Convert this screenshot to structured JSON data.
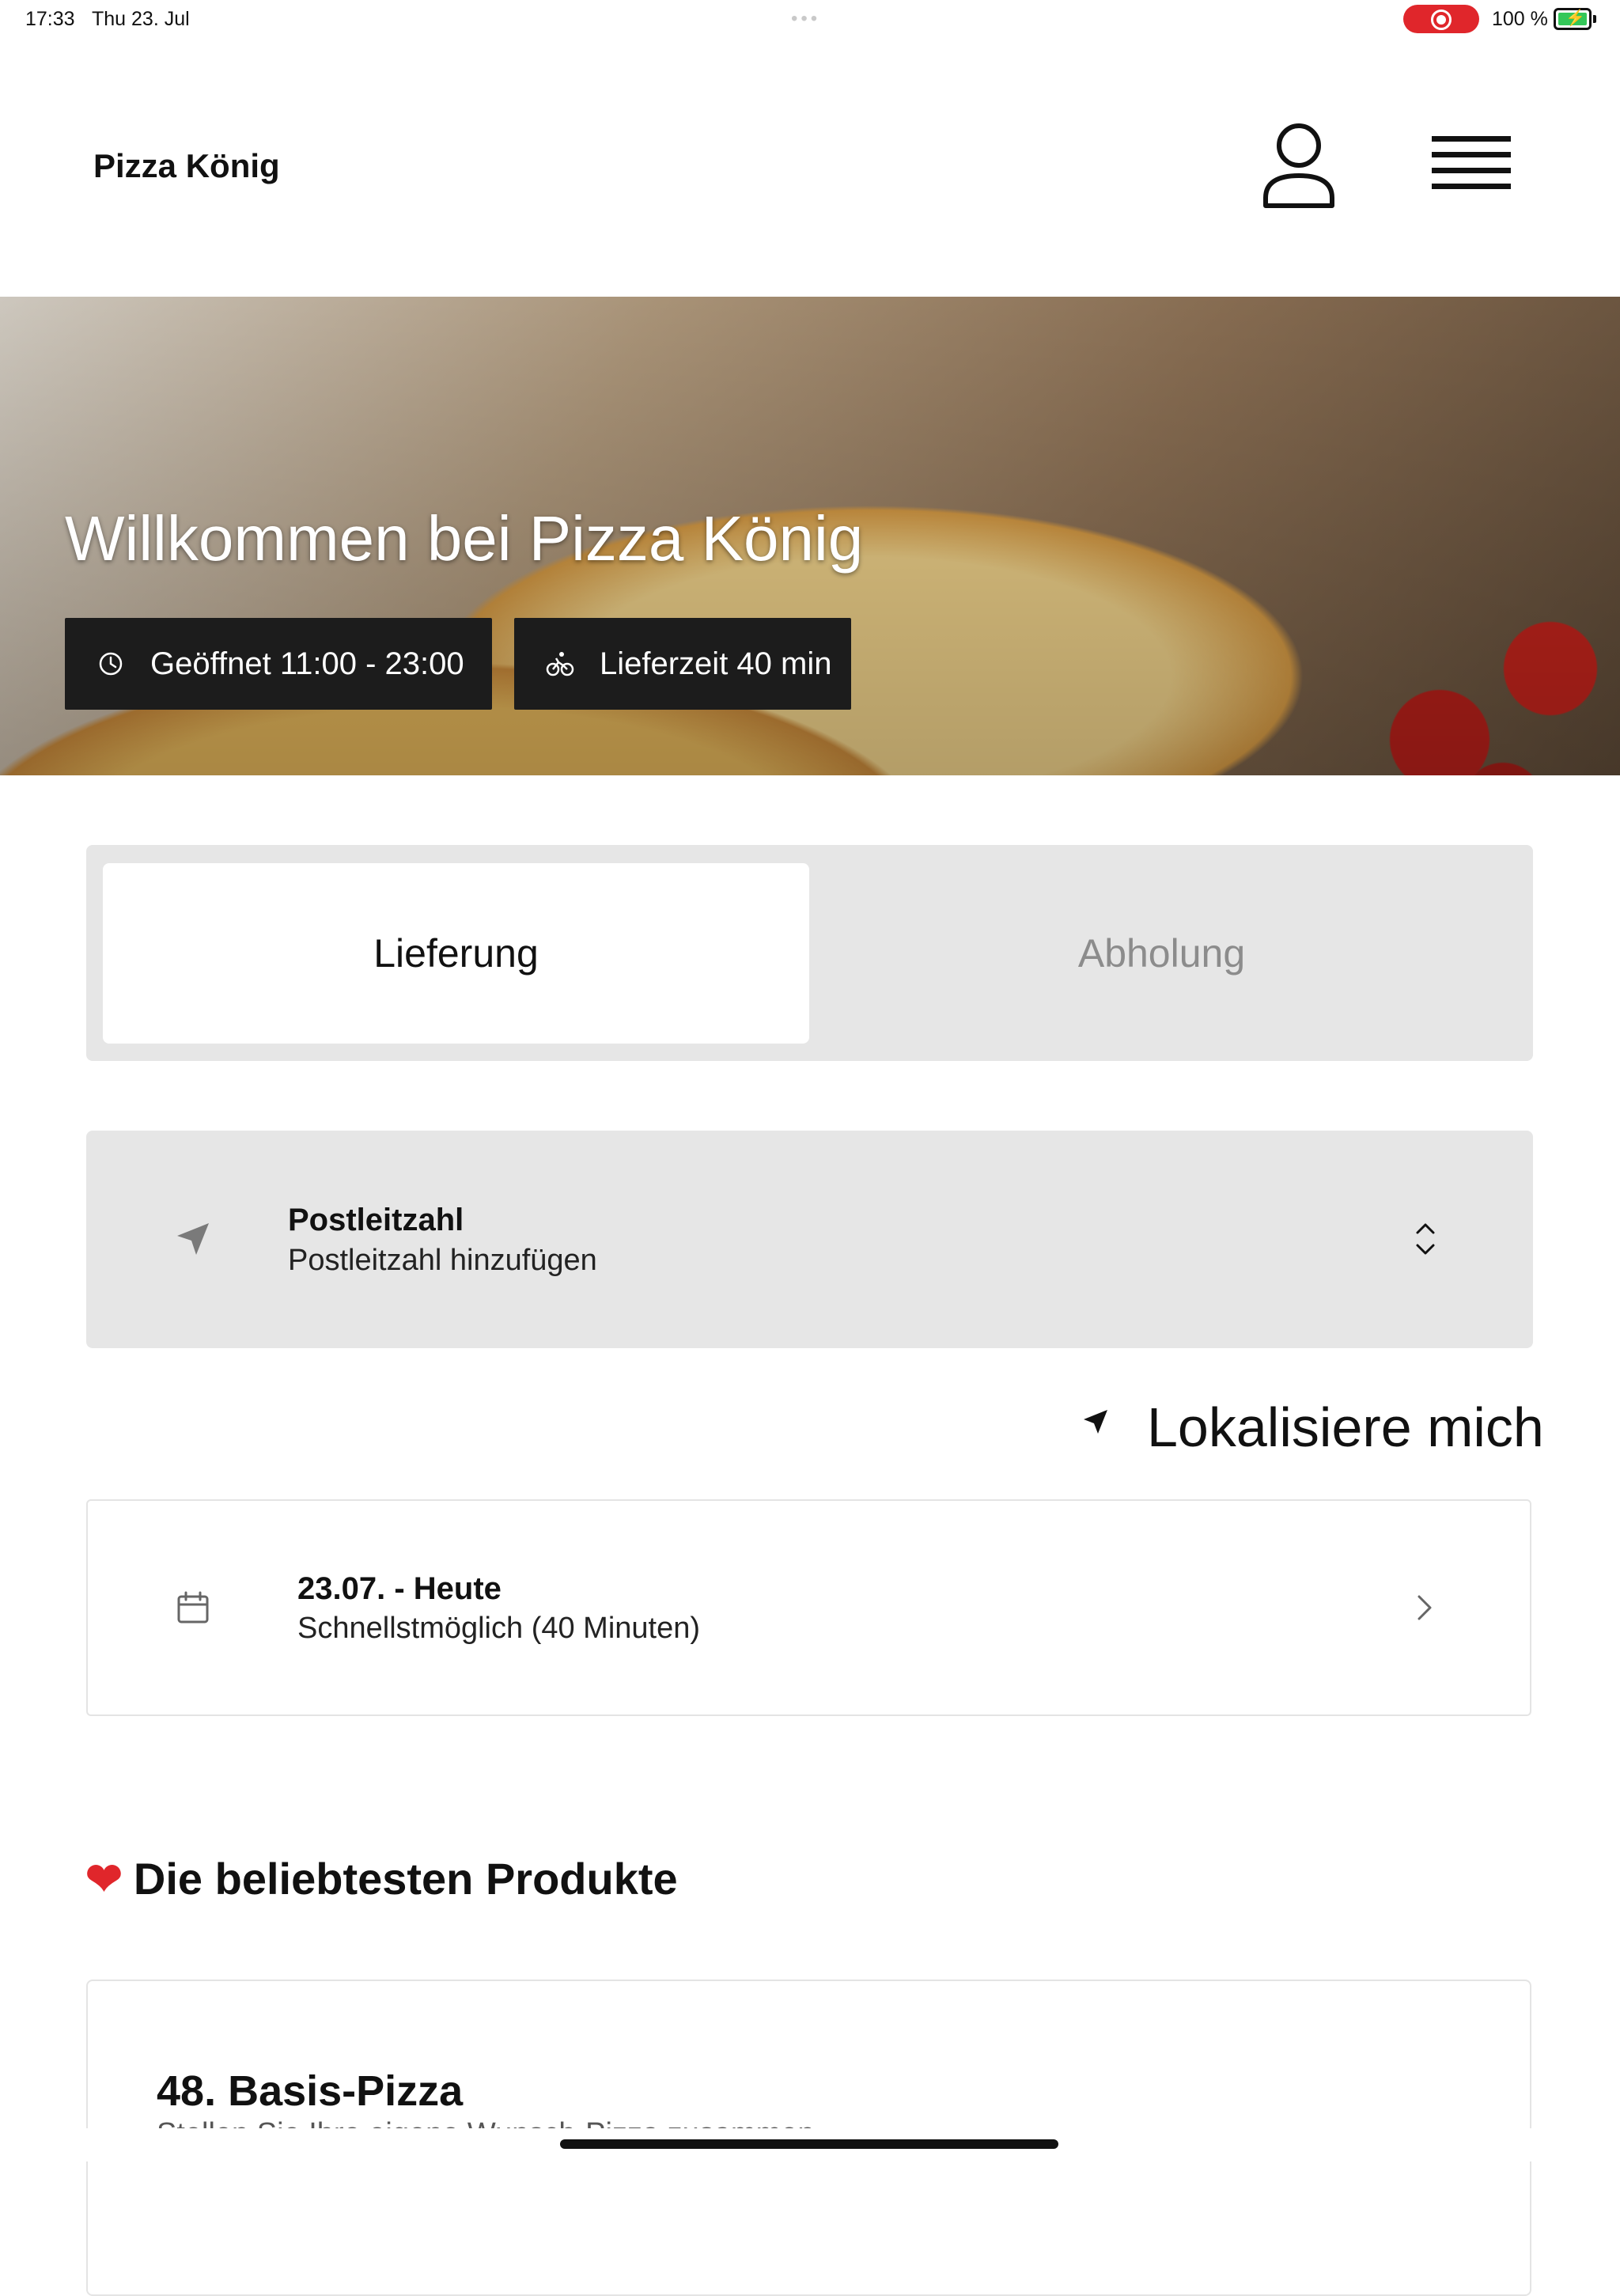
{
  "status_bar": {
    "time": "17:33",
    "date": "Thu 23. Jul",
    "battery": "100 %",
    "multitask": "•••"
  },
  "header": {
    "title": "Pizza König"
  },
  "hero": {
    "title": "Willkommen bei Pizza König",
    "hours": "Geöffnet 11:00 - 23:00",
    "delivery_time": "Lieferzeit 40 min"
  },
  "order_type": {
    "options": [
      "Lieferung",
      "Abholung"
    ],
    "selected": "Lieferung"
  },
  "postcode": {
    "label": "Postleitzahl",
    "placeholder": "Postleitzahl hinzufügen"
  },
  "locate": {
    "label": "Lokalisiere mich"
  },
  "schedule": {
    "date": "23.07. - Heute",
    "time": "Schnellstmöglich (40 Minuten)"
  },
  "popular": {
    "heading": "Die beliebtesten Produkte",
    "products": [
      {
        "name": "48. Basis-Pizza",
        "description": "Stellen Sie Ihre eigene Wunsch-Pizza zusammen"
      }
    ]
  },
  "colors": {
    "accent_red": "#e0262b",
    "chip_background": "#1c1c1c",
    "panel_grey": "#e6e6e6"
  }
}
